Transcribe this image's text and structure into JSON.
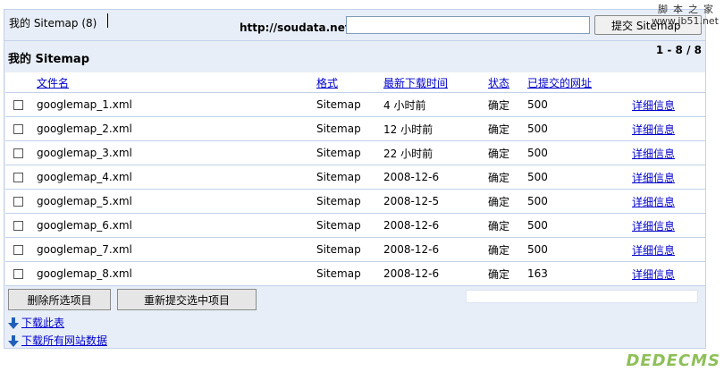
{
  "header": {
    "tab_title": "我的  Sitemap (8)",
    "url_prefix": "http://soudata.net/",
    "url_value": "",
    "submit_label": "提交  Sitemap"
  },
  "section": {
    "title": "我的  Sitemap",
    "pager": "1 - 8 / 8"
  },
  "table": {
    "columns": [
      "文件名",
      "格式",
      "最新下载时间",
      "状态",
      "已提交的网址"
    ],
    "rows": [
      {
        "file": "googlemap_1.xml",
        "format": "Sitemap",
        "downloaded": "4 小时前",
        "status": "确定",
        "urls": "500",
        "detail": "详细信息"
      },
      {
        "file": "googlemap_2.xml",
        "format": "Sitemap",
        "downloaded": "12 小时前",
        "status": "确定",
        "urls": "500",
        "detail": "详细信息"
      },
      {
        "file": "googlemap_3.xml",
        "format": "Sitemap",
        "downloaded": "22 小时前",
        "status": "确定",
        "urls": "500",
        "detail": "详细信息"
      },
      {
        "file": "googlemap_4.xml",
        "format": "Sitemap",
        "downloaded": "2008-12-6",
        "status": "确定",
        "urls": "500",
        "detail": "详细信息"
      },
      {
        "file": "googlemap_5.xml",
        "format": "Sitemap",
        "downloaded": "2008-12-5",
        "status": "确定",
        "urls": "500",
        "detail": "详细信息"
      },
      {
        "file": "googlemap_6.xml",
        "format": "Sitemap",
        "downloaded": "2008-12-6",
        "status": "确定",
        "urls": "500",
        "detail": "详细信息"
      },
      {
        "file": "googlemap_7.xml",
        "format": "Sitemap",
        "downloaded": "2008-12-6",
        "status": "确定",
        "urls": "500",
        "detail": "详细信息"
      },
      {
        "file": "googlemap_8.xml",
        "format": "Sitemap",
        "downloaded": "2008-12-6",
        "status": "确定",
        "urls": "163",
        "detail": "详细信息"
      }
    ]
  },
  "actions": {
    "delete_label": "删除所选项目",
    "resubmit_label": "重新提交选中项目"
  },
  "links": {
    "download_table": "下载此表",
    "download_all": "下载所有网站数据"
  },
  "watermark": {
    "line1": "脚本之家",
    "line2": "www.jb51.net",
    "logo": "DEDECMS"
  },
  "colors": {
    "panel_bg": "#e8eef7",
    "link": "#0000cc",
    "border": "#c3d1ea"
  },
  "icons": {
    "download": "down-arrow-icon",
    "checkbox": "checkbox"
  }
}
